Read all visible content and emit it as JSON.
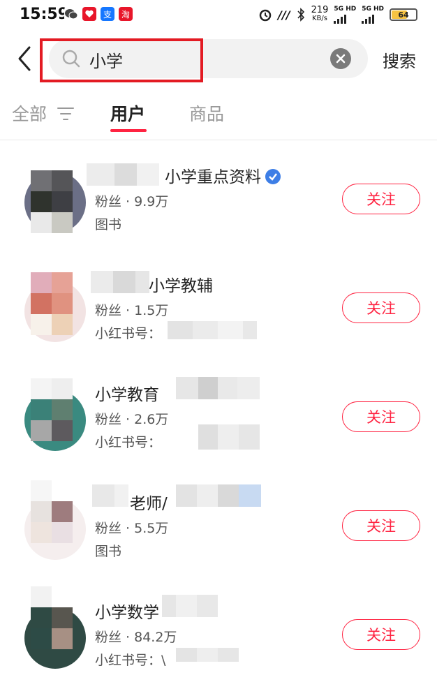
{
  "status_bar": {
    "time": "15:59",
    "speed": "219",
    "speed_unit": "KB/s",
    "net1": "5G HD",
    "net2": "5G HD",
    "battery": "64"
  },
  "search": {
    "query": "小学",
    "button": "搜索"
  },
  "tabs": [
    {
      "label": "全部"
    },
    {
      "label": "用户"
    },
    {
      "label": "商品"
    }
  ],
  "results": [
    {
      "name": "小学重点资料",
      "fans": "粉丝 · 9.9万",
      "sub": "图书",
      "follow": "关注",
      "verified": true
    },
    {
      "name": "小学教辅",
      "fans": "粉丝 · 1.5万",
      "sub": "小红书号：",
      "follow": "关注"
    },
    {
      "name": "小学教育",
      "fans": "粉丝 · 2.6万",
      "sub": "小红书号：",
      "follow": "关注"
    },
    {
      "name": "老师/",
      "fans": "粉丝 · 5.5万",
      "sub": "图书",
      "follow": "关注"
    },
    {
      "name": "小学数学",
      "fans": "粉丝 · 84.2万",
      "sub": "小红书号：\\",
      "follow": "关注"
    }
  ],
  "colors": {
    "accent": "#ff2442",
    "annotation": "#e31b23",
    "verified": "#3d7ee6"
  }
}
